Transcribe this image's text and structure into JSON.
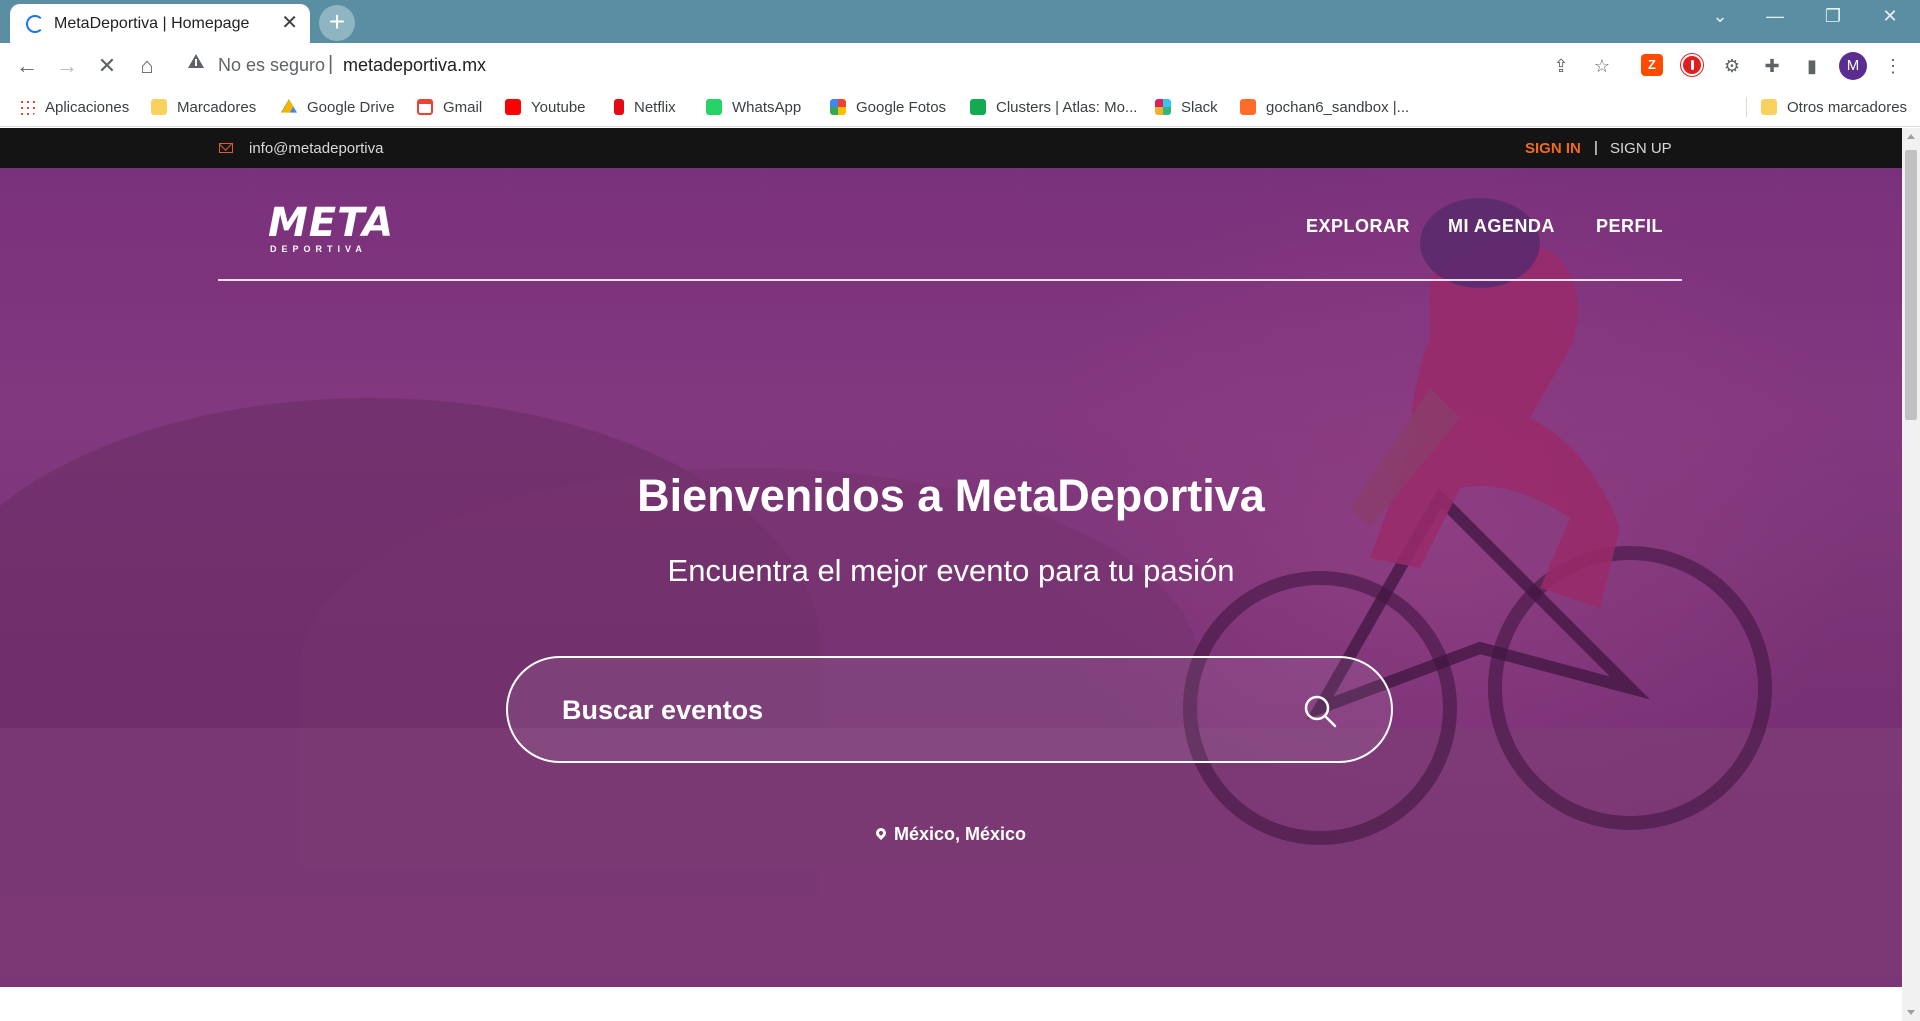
{
  "browser": {
    "tab_title": "MetaDeportiva | Homepage",
    "tab_close": "✕",
    "new_tab": "+",
    "security_label": "No es seguro",
    "address_separator": "|",
    "url": "metadeportiva.mx",
    "profile_initial": "M",
    "extensions": [
      "zotero",
      "adblock",
      "settings-gear",
      "extensions-puzzle",
      "side-panel"
    ],
    "window_controls": [
      "tab-search",
      "minimize",
      "restore",
      "close"
    ]
  },
  "bookmarks": [
    {
      "label": "Aplicaciones",
      "icon": "apps-grid-icon"
    },
    {
      "label": "Marcadores",
      "icon": "folder-icon"
    },
    {
      "label": "Google Drive",
      "icon": "google-drive-icon"
    },
    {
      "label": "Gmail",
      "icon": "gmail-icon"
    },
    {
      "label": "Youtube",
      "icon": "youtube-icon"
    },
    {
      "label": "Netflix",
      "icon": "netflix-icon"
    },
    {
      "label": "WhatsApp",
      "icon": "whatsapp-icon"
    },
    {
      "label": "Google Fotos",
      "icon": "google-photos-icon"
    },
    {
      "label": "Clusters | Atlas: Mo...",
      "icon": "mongodb-icon"
    },
    {
      "label": "Slack",
      "icon": "slack-icon"
    },
    {
      "label": "gochan6_sandbox |...",
      "icon": "cpanel-icon"
    },
    {
      "label": "Otros marcadores",
      "icon": "folder-icon"
    }
  ],
  "topbar": {
    "email": "info@metadeportiva",
    "sign_in": "SIGN IN",
    "divider": "|",
    "sign_up": "SIGN UP"
  },
  "logo": {
    "main": "META",
    "sub": "DEPORTIVA"
  },
  "nav": {
    "items": [
      "EXPLORAR",
      "MI AGENDA",
      "PERFIL"
    ]
  },
  "hero": {
    "title": "Bienvenidos a MetaDeportiva",
    "subtitle": "Encuentra el mejor evento para tu pasión",
    "search_placeholder": "Buscar eventos",
    "location": "México, México"
  },
  "colors": {
    "accent": "#f06a1d",
    "topbar_bg": "#141414",
    "hero_overlay": "#7a2978",
    "browser_frame": "#5a8fa3"
  }
}
